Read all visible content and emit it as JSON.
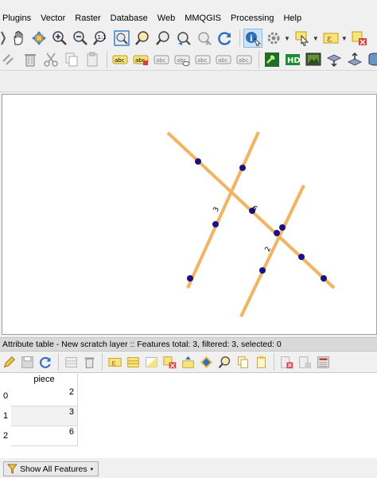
{
  "menubar": {
    "items": [
      "Plugins",
      "Vector",
      "Raster",
      "Database",
      "Web",
      "MMQGIS",
      "Processing",
      "Help"
    ]
  },
  "map": {
    "line_color": "#f5b35e",
    "vertex_color": "#1b0f8a",
    "labels": [
      "3",
      "6",
      "2"
    ]
  },
  "attribute_table": {
    "title": "Attribute table - New scratch layer :: Features total: 3, filtered: 3, selected: 0",
    "column_header": "piece",
    "rows": [
      {
        "index": "0",
        "piece": "2"
      },
      {
        "index": "1",
        "piece": "3"
      },
      {
        "index": "2",
        "piece": "6"
      }
    ]
  },
  "show_all_features_label": "Show All Features"
}
